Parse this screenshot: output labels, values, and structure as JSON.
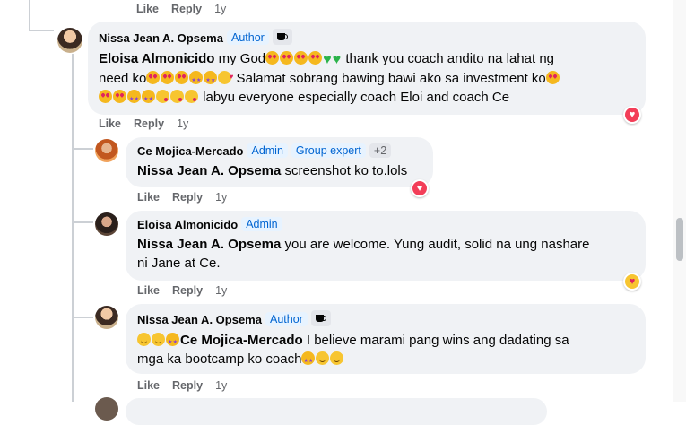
{
  "comments": [
    {
      "author": "Nissa Jean A. Opsema",
      "badges": [
        "Author"
      ],
      "lines": [
        {
          "mention": "Eloisa Almonicido",
          "text1": " my God",
          "text2": " thank you coach andito na lahat ng"
        },
        {
          "text1": "need ko",
          "text2": " Salamat sobrang bawing bawi ako sa investment ko"
        },
        {
          "text1": " labyu everyone especially coach Eloi and coach Ce"
        }
      ],
      "like": "Like",
      "reply": "Reply",
      "time": "1y",
      "reaction": "heart-icon"
    },
    {
      "author": "Ce Mojica-Mercado",
      "badges": [
        "Admin",
        "Group expert",
        "+2"
      ],
      "mention": "Nissa Jean A. Opsema",
      "text": " screenshot ko to.lols",
      "like": "Like",
      "reply": "Reply",
      "time": "1y",
      "reaction": "heart-icon"
    },
    {
      "author": "Eloisa Almonicido",
      "badges": [
        "Admin"
      ],
      "mention": "Nissa Jean A. Opsema",
      "text_line1": " you are welcome. Yung audit, solid na ung nashare",
      "text_line2": "ni Jane at Ce.",
      "like": "Like",
      "reply": "Reply",
      "time": "1y",
      "reaction": "care-icon"
    },
    {
      "author": "Nissa Jean A. Opsema",
      "badges": [
        "Author"
      ],
      "mention": "Ce Mojica-Mercado",
      "text_line1": " I believe marami pang wins ang dadating sa",
      "text_line2": "mga ka bootcamp ko coach",
      "like": "Like",
      "reply": "Reply",
      "time": "1y"
    }
  ],
  "top_actions": {
    "like": "Like",
    "reply": "Reply",
    "time": "1y"
  },
  "colors": {
    "bubble": "#f0f2f5",
    "badge_text": "#0064d1",
    "badge_bg": "#e7f3ff",
    "meta": "#65676b",
    "heart": "#f33e58"
  }
}
